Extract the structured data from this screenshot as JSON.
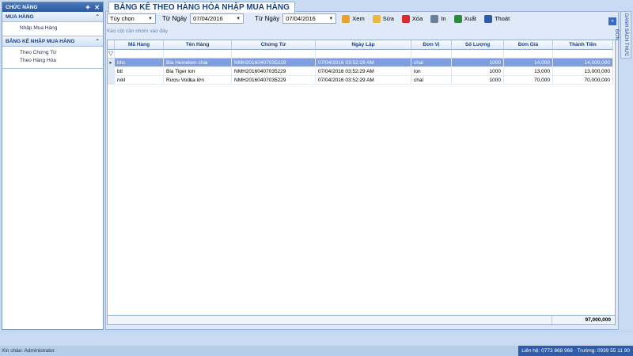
{
  "panel": {
    "title": "CHỨC NĂNG",
    "pin_icon": "pin-icon",
    "close_icon": "close-icon",
    "sections": [
      {
        "title": "MUA HÀNG",
        "items": [
          "Nhập Mua Hàng"
        ]
      },
      {
        "title": "BẢNG KÊ NHẬP MUA HÀNG",
        "items": [
          "Theo Chứng Từ",
          "Theo Hàng Hóa"
        ]
      }
    ]
  },
  "tab": {
    "title": "BẢNG KÊ THEO HÀNG HÓA NHẬP MUA HÀNG"
  },
  "toolbar": {
    "period_value": "Tùy chọn",
    "from_label": "Từ Ngày",
    "from_value": "07/04/2016",
    "to_label": "Từ Ngày",
    "to_value": "07/04/2016",
    "buttons": [
      {
        "label": "Xem",
        "icon": "view-icon",
        "color": "#e8a030"
      },
      {
        "label": "Sửa",
        "icon": "edit-icon",
        "color": "#e8b840"
      },
      {
        "label": "Xóa",
        "icon": "delete-icon",
        "color": "#d92b2b"
      },
      {
        "label": "In",
        "icon": "print-icon",
        "color": "#6b7f98"
      },
      {
        "label": "Xuất",
        "icon": "excel-icon",
        "color": "#2b8a3e"
      },
      {
        "label": "Thoát",
        "icon": "exit-icon",
        "color": "#2f5ca8"
      }
    ]
  },
  "grid": {
    "group_hint": "Kéo cột cần nhóm vào đây",
    "columns": [
      "Mã Hàng",
      "Tên Hàng",
      "Chứng Từ",
      "Ngày Lập",
      "Đơn Vị",
      "Số Lượng",
      "Đơn Giá",
      "Thành Tiền"
    ],
    "rows": [
      [
        "bhc",
        "Bia Heineken chai",
        "NMH20160407035229",
        "07/04/2016 03:52:29 AM",
        "chai",
        "1000",
        "14,000",
        "14,000,000"
      ],
      [
        "btl",
        "Bia Tiger lon",
        "NMH20160407035229",
        "07/04/2016 03:52:29 AM",
        "lon",
        "1000",
        "13,000",
        "13,000,000"
      ],
      [
        "rvkl",
        "Rượu Vodka lớn",
        "NMH20160407035229",
        "07/04/2016 03:52:29 AM",
        "chai",
        "1000",
        "70,000",
        "70,000,000"
      ]
    ],
    "total": "97,000,000"
  },
  "right_tab": "DANH SÁCH THỰC ĐƠN",
  "status": {
    "greeting": "Xin chào: Administrator",
    "contact": "Liên hệ: 0773 868 968 · Trường: 0939 55 11 90"
  }
}
